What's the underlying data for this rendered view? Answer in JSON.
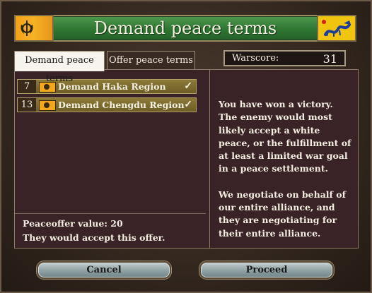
{
  "dialog": {
    "title": "Demand peace terms"
  },
  "tabs": [
    {
      "label": "Demand peace terms",
      "active": true
    },
    {
      "label": "Offer peace terms",
      "active": false
    }
  ],
  "warscore": {
    "label": "Warscore:",
    "value": "31"
  },
  "demands": [
    {
      "cost": "7",
      "label": "Demand Haka Region",
      "selected": true
    },
    {
      "cost": "13",
      "label": "Demand Chengdu Region",
      "selected": true
    }
  ],
  "summary": {
    "peaceoffer_value": "Peaceoffer value: 20",
    "acceptance": "They would accept this offer."
  },
  "description": {
    "paragraph1": "You have won a victory. The enemy would most likely accept a white peace, or the fulfillment of at least a limited war goal in a peace settlement.",
    "paragraph2": "We negotiate on behalf of our entire alliance, and they are negotiating for their entire alliance."
  },
  "buttons": {
    "cancel": "Cancel",
    "proceed": "Proceed"
  },
  "colors": {
    "title_bar": "#2f7533",
    "demand_row": "#7d6c30",
    "panel_bg": "#3a2326",
    "button": "#93a4a7"
  }
}
